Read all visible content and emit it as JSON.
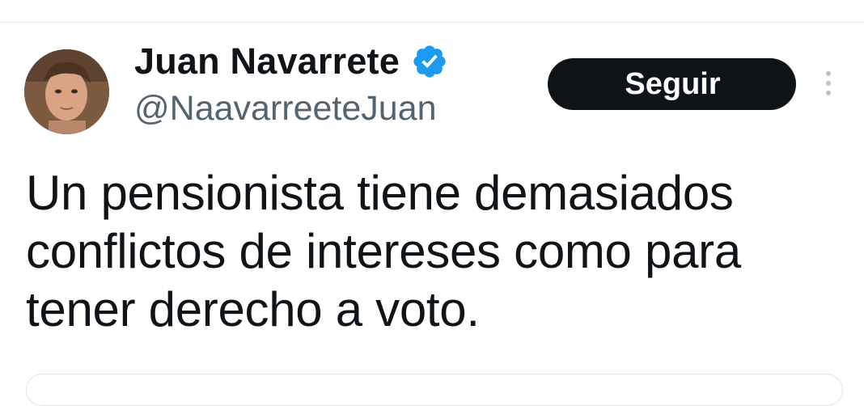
{
  "tweet": {
    "author": {
      "display_name": "Juan Navarrete",
      "handle": "@NaavarreeteJuan",
      "verified": true,
      "verified_icon": "verified-badge-icon",
      "avatar_icon": "avatar-photo"
    },
    "follow_button_label": "Seguir",
    "more_icon": "more-vertical-icon",
    "text": "Un pensionista tiene demasiados conflictos de intereses como para tener derecho a voto."
  },
  "colors": {
    "text_primary": "#0f1419",
    "text_secondary": "#536471",
    "verified_blue": "#1d9bf0",
    "button_bg": "#0f1419",
    "button_text": "#ffffff",
    "divider": "#e6e9ec"
  }
}
